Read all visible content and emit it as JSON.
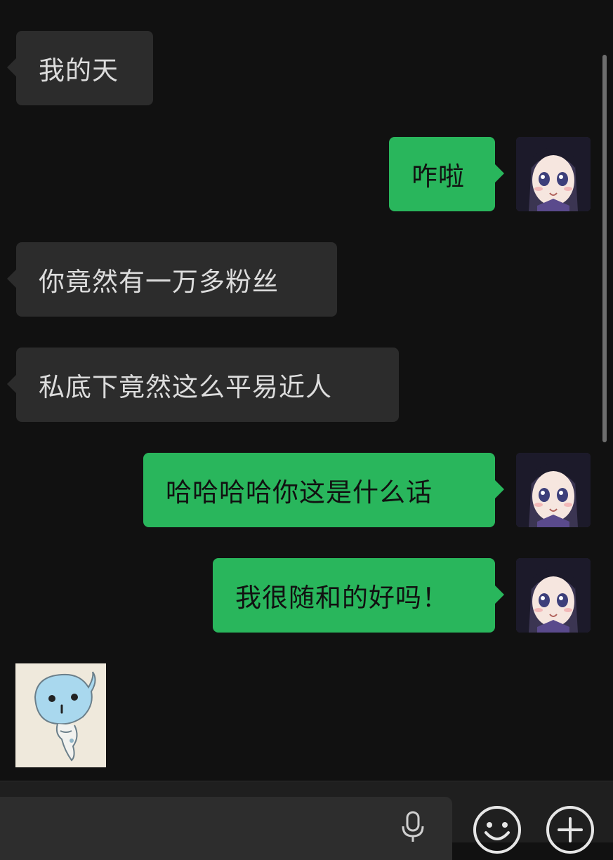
{
  "messages": [
    {
      "side": "in",
      "text": "我的天"
    },
    {
      "side": "out",
      "text": "咋啦"
    },
    {
      "side": "in",
      "text": "你竟然有一万多粉丝"
    },
    {
      "side": "in",
      "text": "私底下竟然这么平易近人"
    },
    {
      "side": "out",
      "text": "哈哈哈哈你这是什么话"
    },
    {
      "side": "out",
      "text": "我很随和的好吗！"
    }
  ],
  "input": {
    "value": "",
    "placeholder": ""
  },
  "icons": {
    "voice": "microphone-icon",
    "emoji": "emoji-icon",
    "more": "plus-circle-icon"
  },
  "colors": {
    "background": "#111111",
    "incoming_bubble": "#2c2c2c",
    "outgoing_bubble": "#29b65c"
  }
}
